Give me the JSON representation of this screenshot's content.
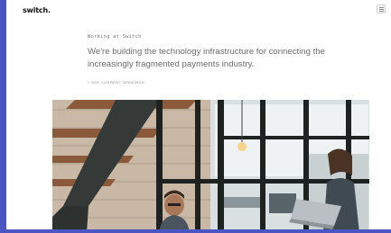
{
  "header": {
    "logo_text": "switch.",
    "menu_icon": "hamburger-icon"
  },
  "intro": {
    "kicker": "Working at Switch",
    "headline": "We're building the technology infrastructure for connecting the increasingly fragmented payments industry.",
    "openings_link": "+ SEE CURRENT OPENINGS"
  },
  "hero": {
    "description": "office photo"
  },
  "colors": {
    "accent_frame": "#4b55c3",
    "text_muted": "#6b6b6b"
  }
}
